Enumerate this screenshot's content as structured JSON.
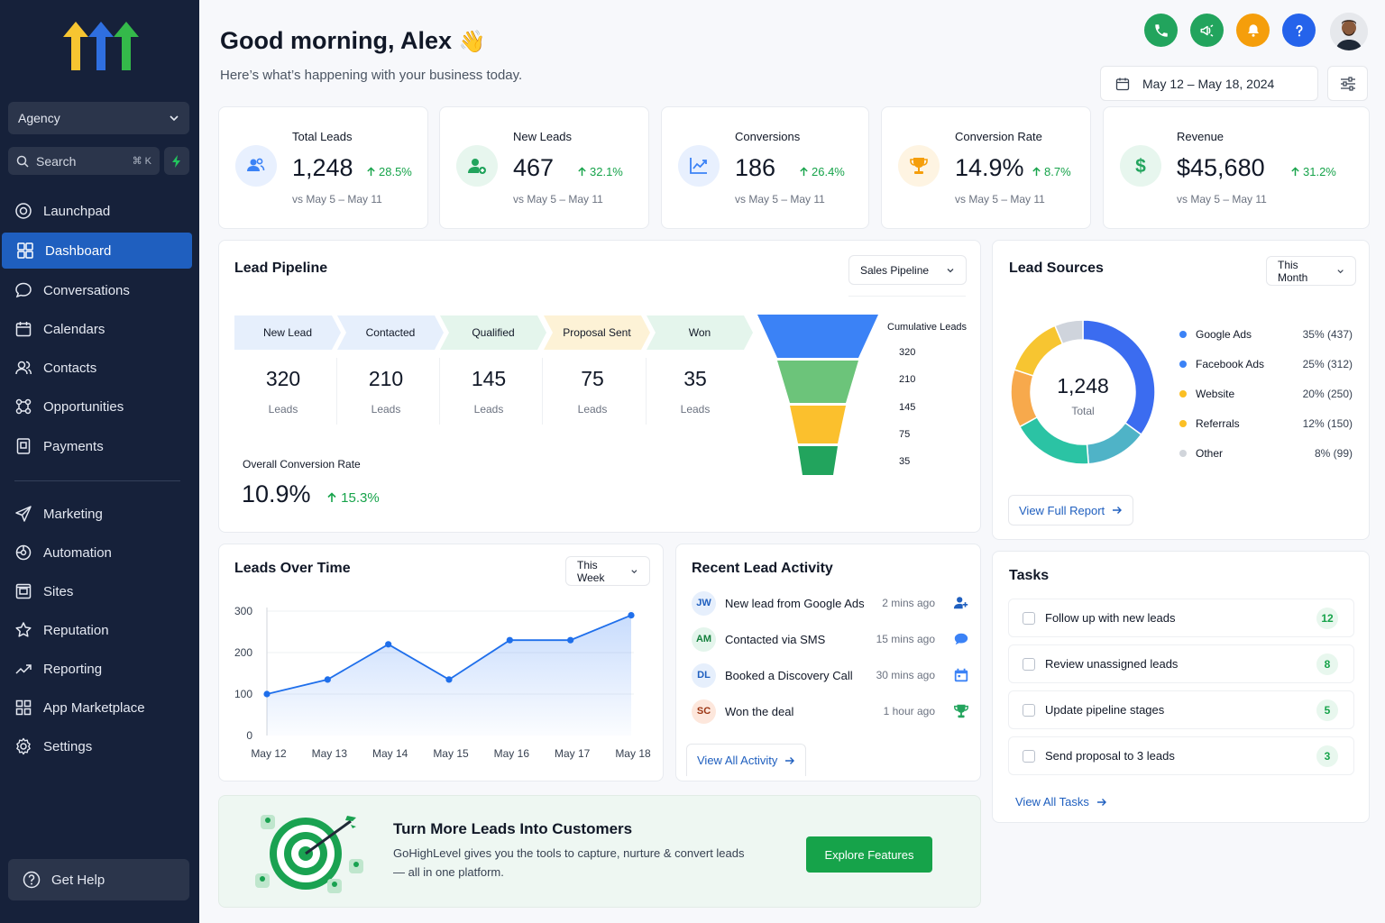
{
  "sidebar": {
    "agency": "Agency",
    "search": {
      "label": "Search",
      "shortcut": "⌘ K"
    },
    "items": [
      {
        "label": "Launchpad",
        "icon": "launchpad-icon"
      },
      {
        "label": "Dashboard",
        "icon": "dashboard-icon",
        "active": true
      },
      {
        "label": "Conversations",
        "icon": "chat-icon"
      },
      {
        "label": "Calendars",
        "icon": "calendar-icon"
      },
      {
        "label": "Contacts",
        "icon": "contacts-icon"
      },
      {
        "label": "Opportunities",
        "icon": "opportunities-icon"
      },
      {
        "label": "Payments",
        "icon": "payments-icon"
      },
      {
        "label": "Marketing",
        "icon": "send-icon"
      },
      {
        "label": "Automation",
        "icon": "automation-icon"
      },
      {
        "label": "Sites",
        "icon": "sites-icon"
      },
      {
        "label": "Reputation",
        "icon": "star-icon"
      },
      {
        "label": "Reporting",
        "icon": "trend-icon"
      },
      {
        "label": "App Marketplace",
        "icon": "grid-icon"
      },
      {
        "label": "Settings",
        "icon": "gear-icon"
      }
    ],
    "help": "Get Help"
  },
  "header": {
    "greeting": "Good morning, Alex",
    "emoji": "👋",
    "subtitle": "Here’s what’s happening with your business today.",
    "date_range": "May 12 – May 18, 2024"
  },
  "stats": [
    {
      "label": "Total Leads",
      "value": "1,248",
      "delta": "28.5%",
      "compare": "vs May 5 – May 11",
      "color": "#3b82f6",
      "bg": "#e8f0fe"
    },
    {
      "label": "New Leads",
      "value": "467",
      "delta": "32.1%",
      "compare": "vs May 5 – May 11",
      "color": "#22a45d",
      "bg": "#e7f6ee"
    },
    {
      "label": "Conversions",
      "value": "186",
      "delta": "26.4%",
      "compare": "vs May 5 – May 11",
      "color": "#3b82f6",
      "bg": "#e8f0fe"
    },
    {
      "label": "Conversion Rate",
      "value": "14.9%",
      "delta": "8.7%",
      "compare": "vs May 5 – May 11",
      "color": "#f59e0b",
      "bg": "#fef4e2"
    },
    {
      "label": "Revenue",
      "value": "$45,680",
      "delta": "31.2%",
      "compare": "vs May 5 – May 11",
      "color": "#22a45d",
      "bg": "#e7f6ee"
    }
  ],
  "pipeline": {
    "title": "Lead Pipeline",
    "selector": "Sales Pipeline",
    "stages": [
      {
        "name": "New Lead",
        "count": "320",
        "unit": "Leads",
        "color": "#e6effc"
      },
      {
        "name": "Contacted",
        "count": "210",
        "unit": "Leads",
        "color": "#e6effc"
      },
      {
        "name": "Qualified",
        "count": "145",
        "unit": "Leads",
        "color": "#e4f5ec"
      },
      {
        "name": "Proposal Sent",
        "count": "75",
        "unit": "Leads",
        "color": "#fdf2d6"
      },
      {
        "name": "Won",
        "count": "35",
        "unit": "Leads",
        "color": "#e4f5ec"
      }
    ],
    "conv_label": "Overall Conversion Rate",
    "conv_value": "10.9%",
    "conv_delta": "15.3%",
    "funnel_title": "Cumulative Leads",
    "funnel_levels": [
      "320",
      "210",
      "145",
      "75",
      "35"
    ],
    "funnel_colors": [
      "#3b82f6",
      "#6cc47a",
      "#fbc02d",
      "#22a45d"
    ]
  },
  "sources": {
    "title": "Lead Sources",
    "selector": "This Month",
    "total": "1,248",
    "total_label": "Total",
    "link": "View Full Report"
  },
  "leads_time": {
    "title": "Leads Over Time",
    "selector": "This Week"
  },
  "activity": {
    "title": "Recent Lead Activity",
    "items": [
      {
        "initials": "JW",
        "text": "New lead from Google Ads",
        "time": "2 mins ago",
        "bg": "#e6effc",
        "fg": "#1f5fbf",
        "icon": "add-user-icon"
      },
      {
        "initials": "AM",
        "text": "Contacted via SMS",
        "time": "15 mins ago",
        "bg": "#e4f5ec",
        "fg": "#15803d",
        "icon": "chat-bubble-icon"
      },
      {
        "initials": "DL",
        "text": "Booked a Discovery Call",
        "time": "30 mins ago",
        "bg": "#e6effc",
        "fg": "#1f5fbf",
        "icon": "calendar-icon"
      },
      {
        "initials": "SC",
        "text": "Won the deal",
        "time": "1 hour ago",
        "bg": "#fde7dc",
        "fg": "#9a3412",
        "icon": "trophy-icon"
      }
    ],
    "link": "View All Activity"
  },
  "tasks": {
    "title": "Tasks",
    "items": [
      {
        "label": "Follow up with new leads",
        "count": "12"
      },
      {
        "label": "Review unassigned leads",
        "count": "8"
      },
      {
        "label": "Update pipeline stages",
        "count": "5"
      },
      {
        "label": "Send proposal to 3 leads",
        "count": "3"
      }
    ],
    "link": "View All Tasks"
  },
  "banner": {
    "title": "Turn More Leads Into Customers",
    "line1": "GoHighLevel gives you the tools to capture, nurture & convert leads",
    "line2": "— all in one platform.",
    "button": "Explore Features"
  },
  "chart_data": [
    {
      "type": "line",
      "categories": [
        "May 12",
        "May 13",
        "May 14",
        "May 15",
        "May 16",
        "May 17",
        "May 18"
      ],
      "series": [
        {
          "values": [
            100,
            135,
            220,
            135,
            230,
            230,
            290
          ]
        }
      ],
      "ylim": [
        0,
        300
      ],
      "yticks": [
        "0",
        "100",
        "200",
        "300"
      ],
      "grid": true,
      "color": "#1f6feb"
    },
    {
      "type": "pie",
      "categories": [
        "Google Ads",
        "Facebook Ads",
        "Website",
        "Referrals",
        "Other"
      ],
      "values": [
        437,
        312,
        250,
        150,
        99
      ],
      "percent_labels": [
        "35% (437)",
        "25% (312)",
        "20% (250)",
        "12% (150)",
        "8% (99)"
      ],
      "legend_dots": [
        "#3b82f6",
        "#3b82f6",
        "#fbbf24",
        "#fbbf24",
        "#d1d5db"
      ],
      "ring_colors": [
        "#3b6cf0",
        "#4fb3c7",
        "#2bc3a4",
        "#f7a94c",
        "#f7c531",
        "#cfd4dc"
      ],
      "legend": "right"
    }
  ]
}
